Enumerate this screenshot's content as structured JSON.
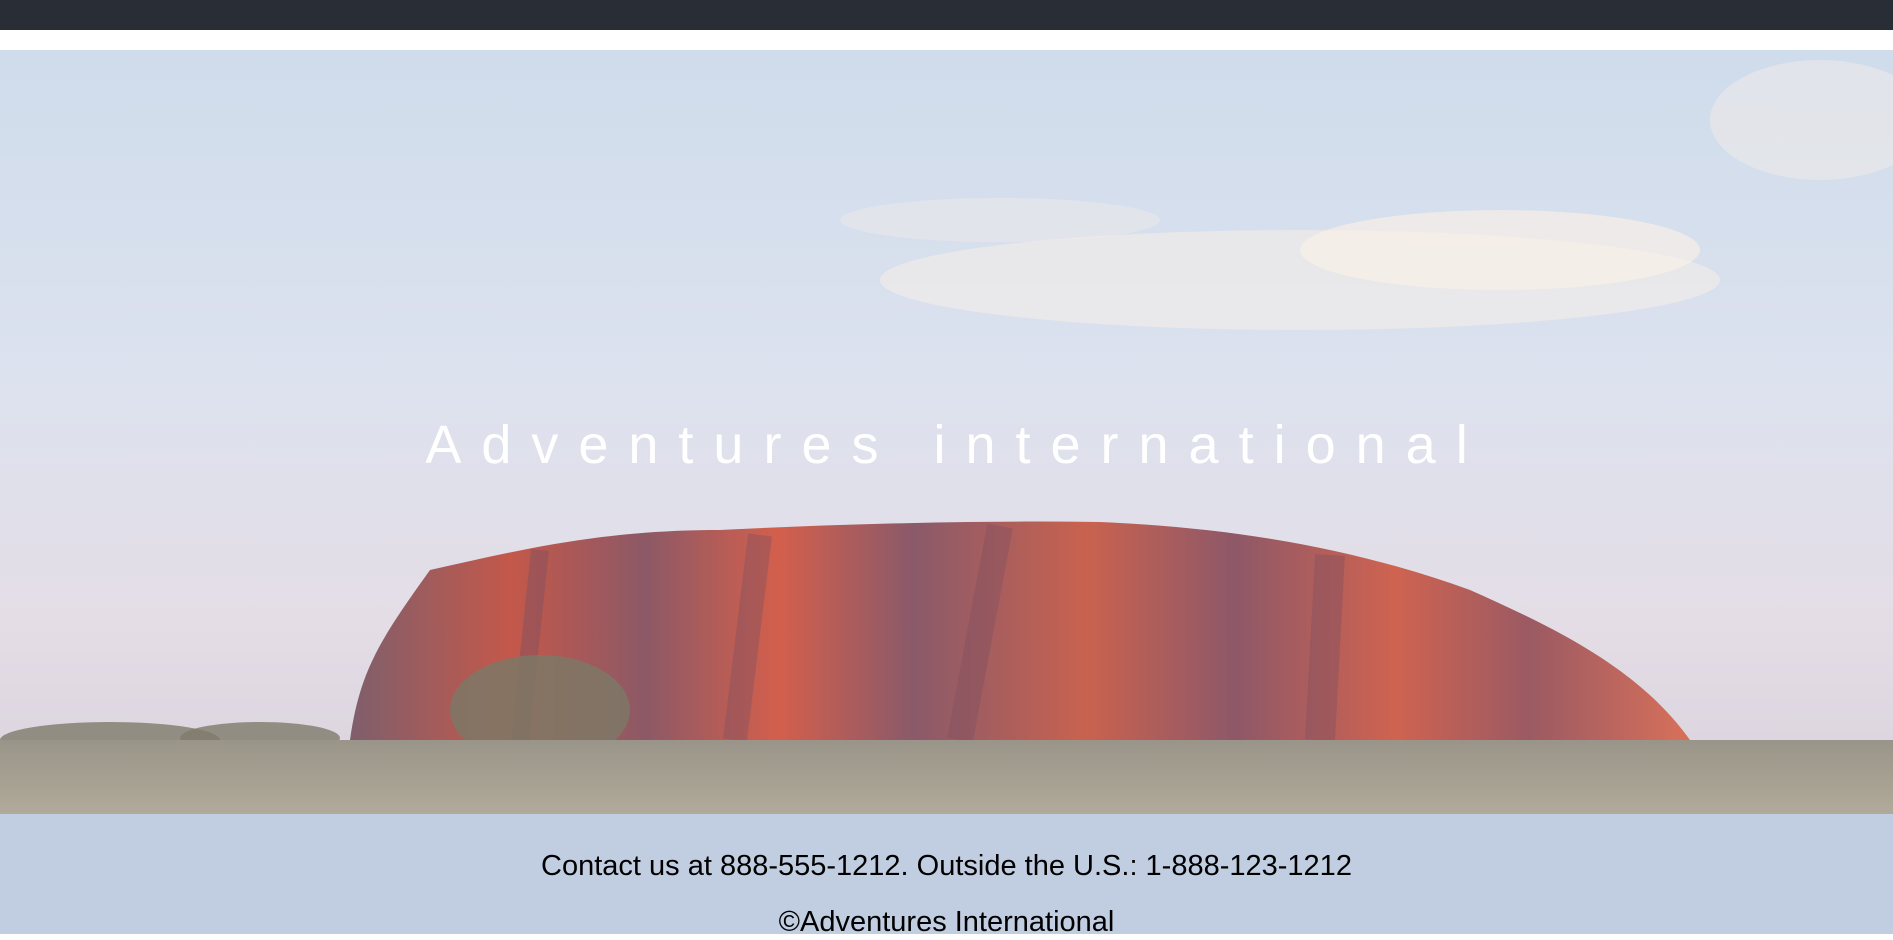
{
  "hero": {
    "title": "Adventures international",
    "image_subject": "red monolith rock at dusk under pale sky"
  },
  "footer": {
    "contact": "Contact us at 888-555-1212. Outside the U.S.: 1-888-123-1212",
    "copyright": "©Adventures International",
    "background_color": "#c1cde0"
  },
  "topbar": {
    "color": "#282d36"
  }
}
